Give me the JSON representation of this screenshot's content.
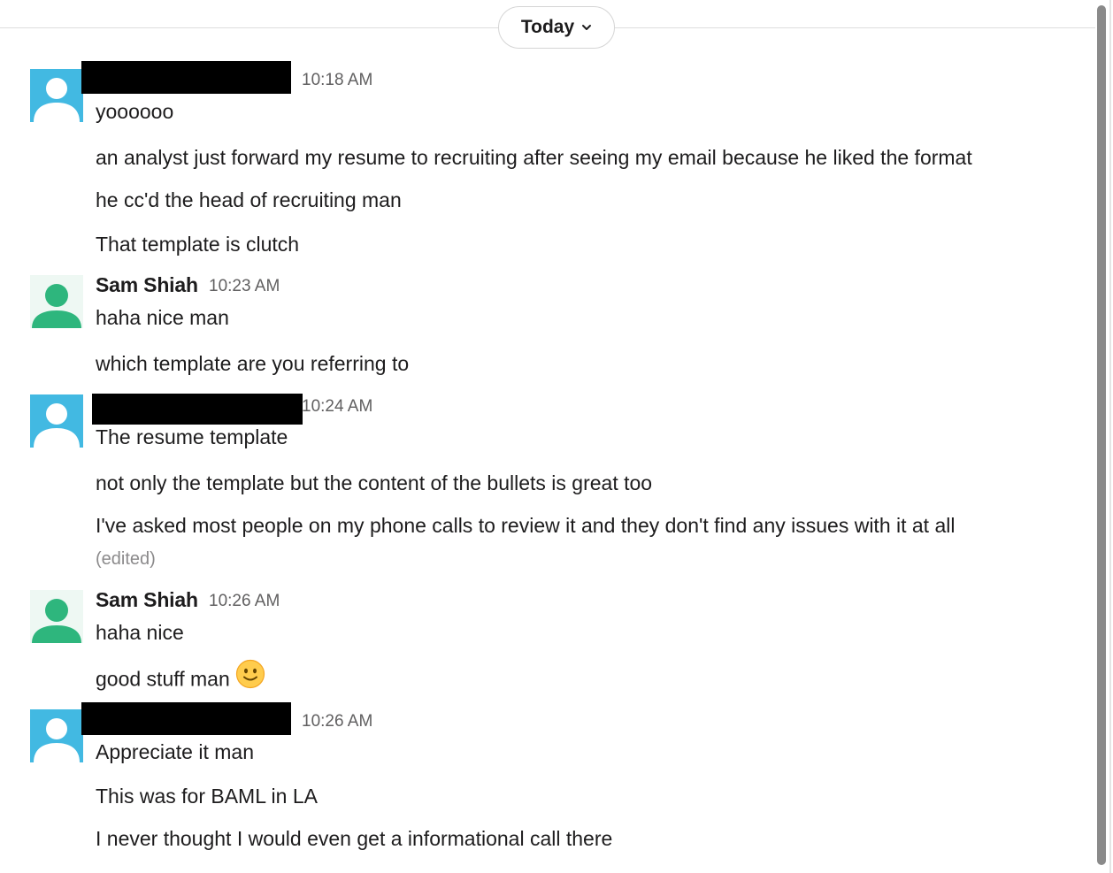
{
  "day_divider": {
    "label": "Today"
  },
  "colors": {
    "avatar_blue": "#42b9e2",
    "avatar_green": "#2eb67d",
    "text": "#1d1c1d",
    "timestamp": "#616061",
    "redaction": "#000000"
  },
  "messages": [
    {
      "author": "",
      "author_redacted": true,
      "avatar_icon": "user-avatar-blue-icon",
      "time": "10:18 AM",
      "lines": [
        "yoooooo",
        "an analyst just forward my resume to recruiting after seeing my email because he liked the format",
        "he cc'd the head of recruiting man",
        "That template is clutch"
      ]
    },
    {
      "author": "Sam Shiah",
      "author_redacted": false,
      "avatar_icon": "user-avatar-green-icon",
      "time": "10:23 AM",
      "lines": [
        "haha nice man",
        "which template are you referring to"
      ]
    },
    {
      "author": "",
      "author_redacted": true,
      "avatar_icon": "user-avatar-blue-icon",
      "time": "10:24 AM",
      "lines": [
        "The resume template",
        "not only the template but the content of the bullets is great too",
        "I've asked most people on my phone calls to review it and they don't find any issues with it at all"
      ],
      "edited_label": "(edited)"
    },
    {
      "author": "Sam Shiah",
      "author_redacted": false,
      "avatar_icon": "user-avatar-green-icon",
      "time": "10:26 AM",
      "lines": [
        "haha nice",
        "good stuff man"
      ],
      "emoji_icon": "slightly-smiling-face-icon"
    },
    {
      "author": "",
      "author_redacted": true,
      "avatar_icon": "user-avatar-blue-icon",
      "time": "10:26 AM",
      "lines": [
        "Appreciate it man",
        "This was for BAML in LA",
        "I never thought I would even get a informational call there"
      ]
    }
  ]
}
